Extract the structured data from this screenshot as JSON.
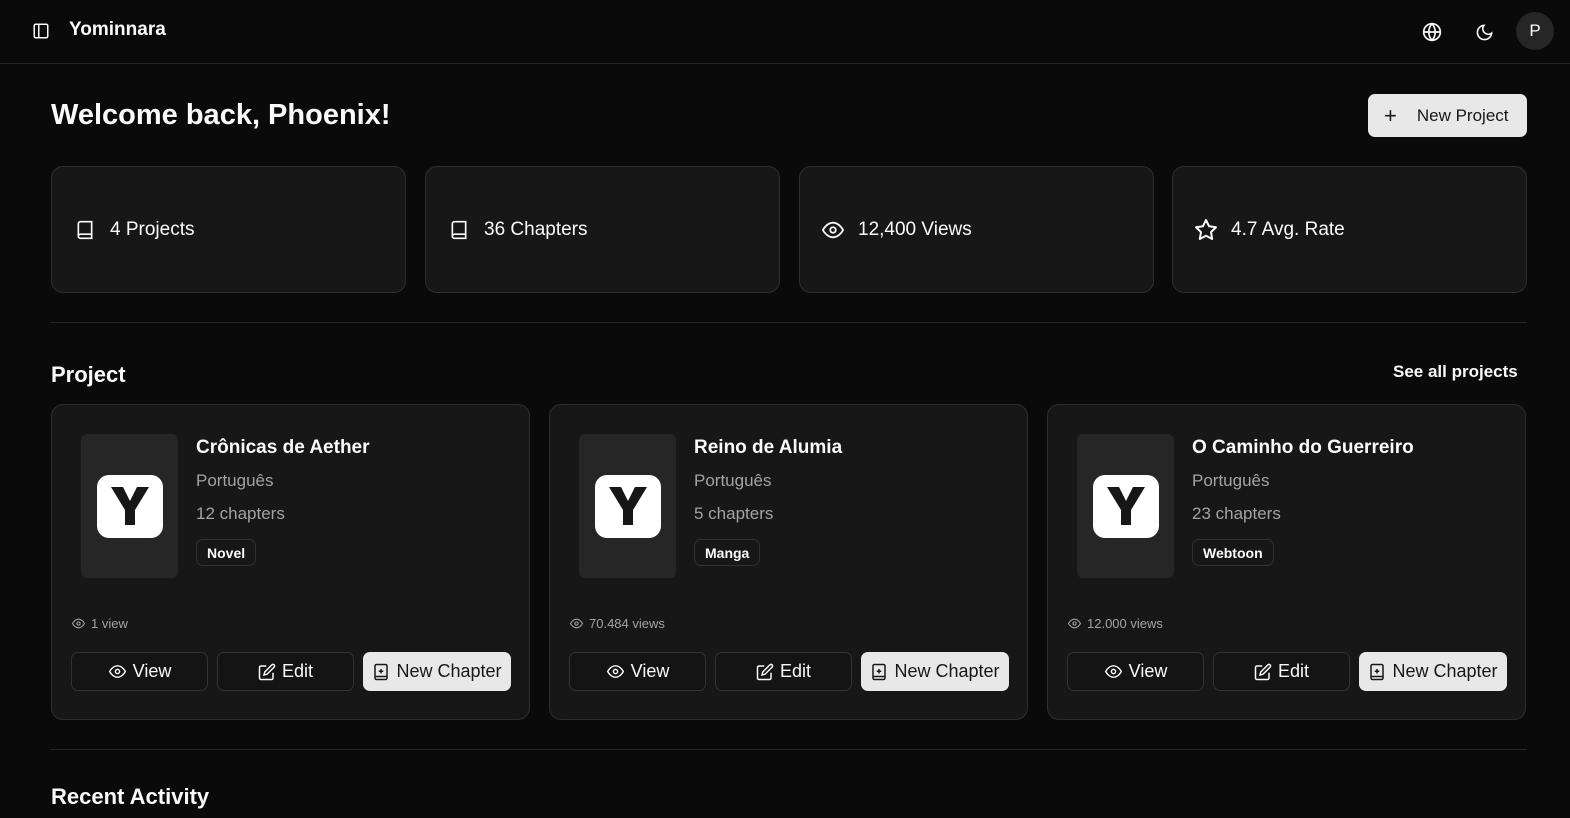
{
  "app": {
    "name": "Yominnara",
    "user_initial": "P"
  },
  "header": {
    "welcome": "Welcome back, Phoenix!",
    "new_project_label": "New Project"
  },
  "stats": [
    {
      "icon": "book-icon",
      "label": "4 Projects"
    },
    {
      "icon": "book-icon",
      "label": "36 Chapters"
    },
    {
      "icon": "eye-icon",
      "label": "12,400 Views"
    },
    {
      "icon": "star-icon",
      "label": "4.7 Avg. Rate"
    }
  ],
  "projects_section": {
    "title": "Project",
    "see_all": "See all projects"
  },
  "projects": [
    {
      "title": "Crônicas de Aether",
      "language": "Português",
      "chapters": "12 chapters",
      "type": "Novel",
      "views": "1 view"
    },
    {
      "title": "Reino de Alumia",
      "language": "Português",
      "chapters": "5 chapters",
      "type": "Manga",
      "views": "70.484 views"
    },
    {
      "title": "O Caminho do Guerreiro",
      "language": "Português",
      "chapters": "23 chapters",
      "type": "Webtoon",
      "views": "12.000 views"
    }
  ],
  "card_actions": {
    "view": "View",
    "edit": "Edit",
    "new_chapter": "New Chapter"
  },
  "cover_letter": "Y",
  "recent_activity": {
    "title": "Recent Activity"
  }
}
